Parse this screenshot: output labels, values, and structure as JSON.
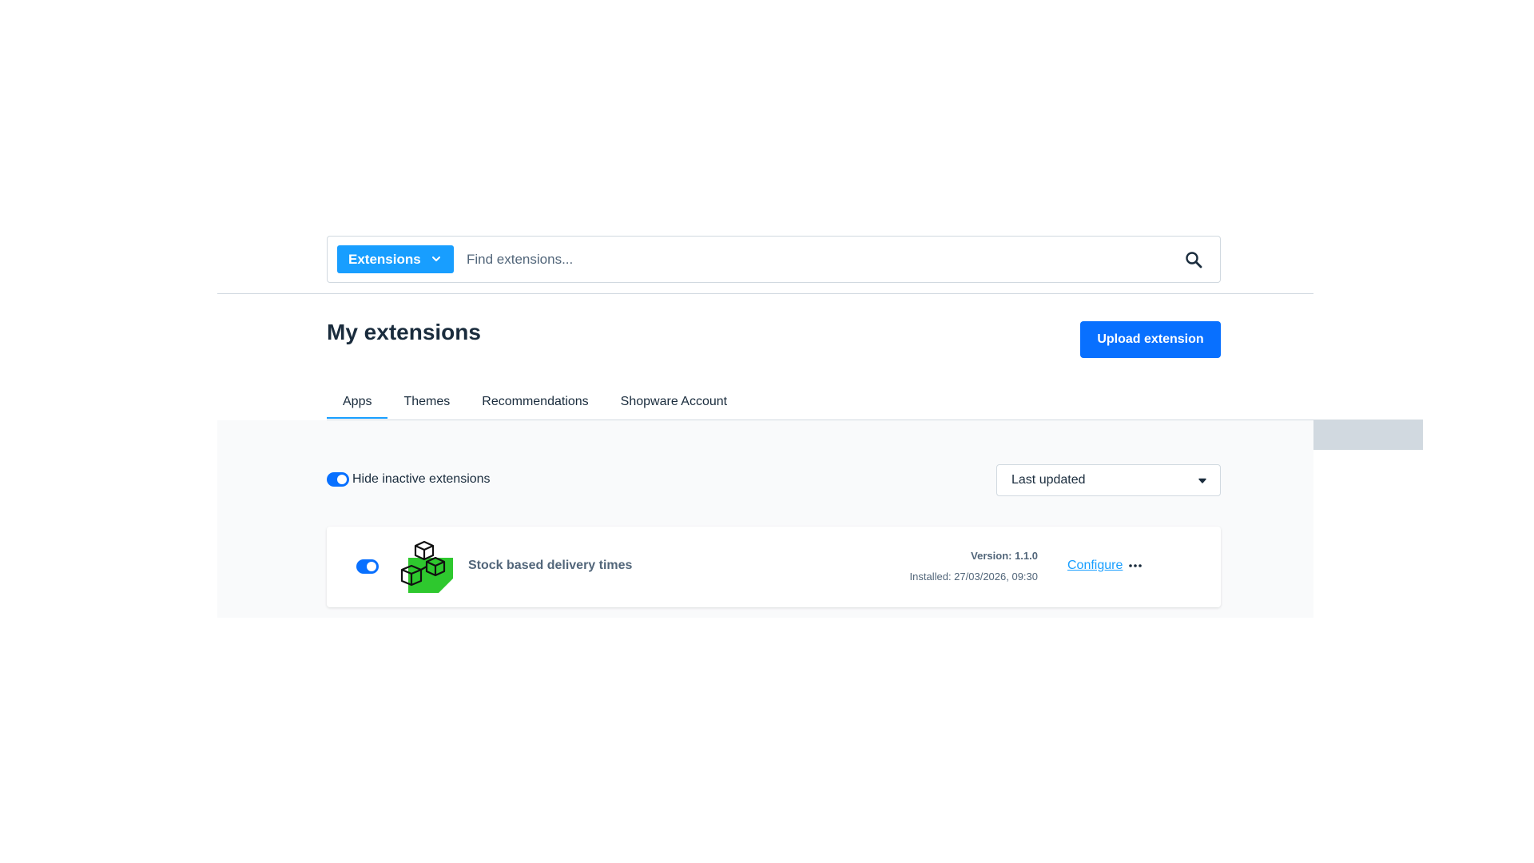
{
  "search": {
    "type_label": "Extensions",
    "placeholder": "Find extensions..."
  },
  "header": {
    "title": "My extensions",
    "upload_label": "Upload extension"
  },
  "tabs": [
    {
      "label": "Apps",
      "active": true
    },
    {
      "label": "Themes",
      "active": false
    },
    {
      "label": "Recommendations",
      "active": false
    },
    {
      "label": "Shopware Account",
      "active": false
    }
  ],
  "filters": {
    "hide_inactive_label": "Hide inactive extensions",
    "hide_inactive_on": true,
    "sort_value": "Last updated"
  },
  "extensions": [
    {
      "name": "Stock based delivery times",
      "active": true,
      "version": "Version: 1.1.0",
      "installed": "Installed: 27/03/2026, 09:30",
      "configure_label": "Configure",
      "icon": "cubes-icon"
    }
  ],
  "colors": {
    "primary": "#0870ff",
    "accent": "#189eff",
    "text": "#1a2c3d",
    "muted": "#52667a",
    "icon_green": "#2ec82e"
  }
}
